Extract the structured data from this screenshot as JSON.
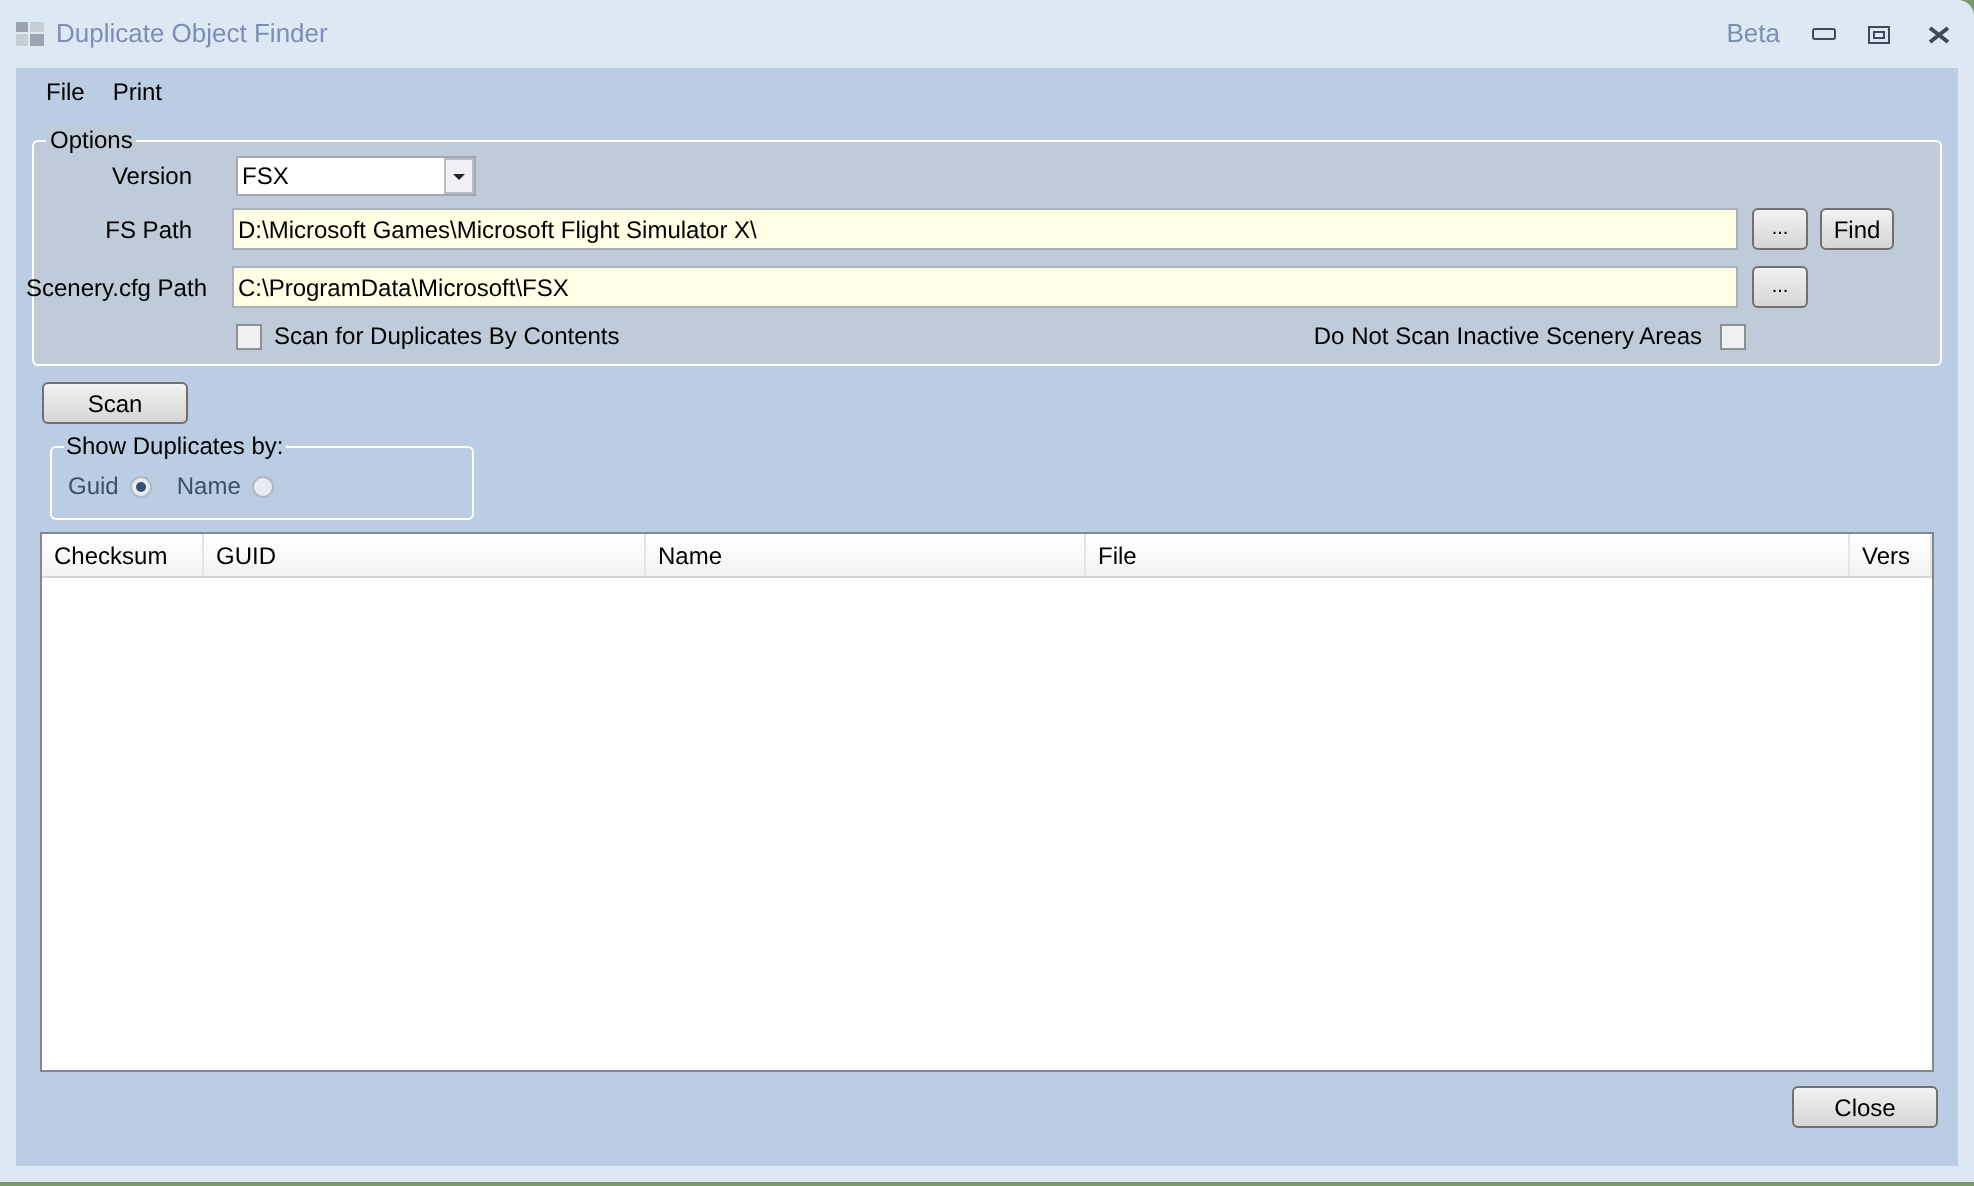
{
  "window": {
    "title": "Duplicate Object Finder",
    "badge": "Beta"
  },
  "menu": [
    "File",
    "Print"
  ],
  "options": {
    "title": "Options",
    "version": {
      "label": "Version",
      "value": "FSX"
    },
    "fs_path": {
      "label": "FS Path",
      "value": "D:\\Microsoft Games\\Microsoft Flight Simulator X\\",
      "browse": "...",
      "find": "Find"
    },
    "scenery_path": {
      "label": "Scenery.cfg Path",
      "value": "C:\\ProgramData\\Microsoft\\FSX",
      "browse": "..."
    },
    "scan_by_contents": {
      "label": "Scan for Duplicates By Contents",
      "checked": false
    },
    "skip_inactive": {
      "label": "Do Not Scan Inactive Scenery Areas",
      "checked": false
    }
  },
  "scan_button": "Scan",
  "show_duplicates": {
    "title": "Show Duplicates by:",
    "options": [
      {
        "label": "Guid",
        "selected": true
      },
      {
        "label": "Name",
        "selected": false
      }
    ]
  },
  "table": {
    "columns": [
      "Checksum",
      "GUID",
      "Name",
      "File",
      "Vers"
    ]
  },
  "close_button": "Close"
}
